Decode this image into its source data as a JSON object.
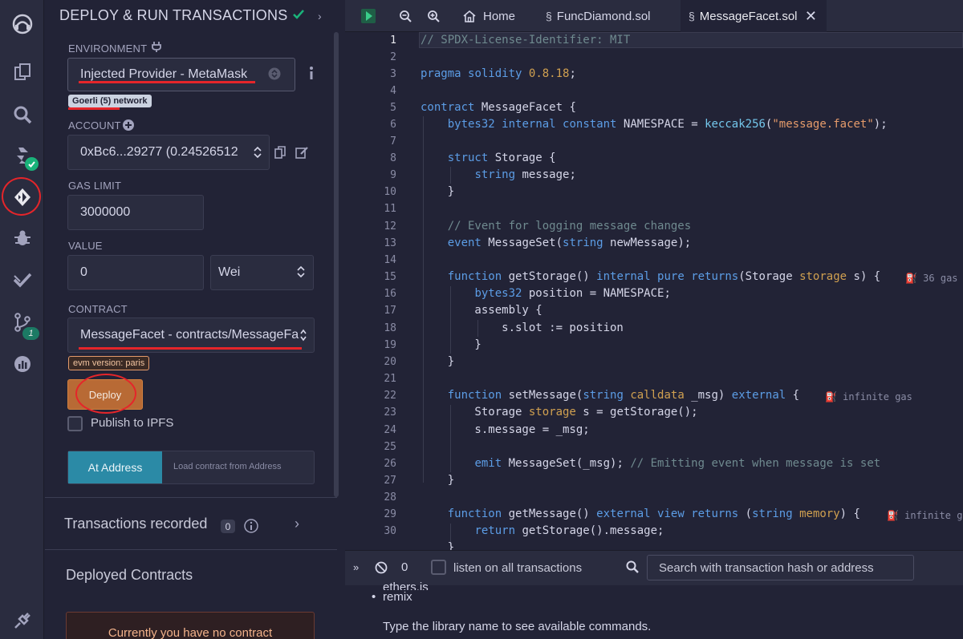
{
  "panel": {
    "title": "DEPLOY & RUN TRANSACTIONS",
    "environment_label": "ENVIRONMENT",
    "environment_value": "Injected Provider - MetaMask",
    "network_badge": "Goerli (5) network",
    "account_label": "ACCOUNT",
    "account_value": "0xBc6...29277 (0.24526512",
    "gas_limit_label": "GAS LIMIT",
    "gas_limit_value": "3000000",
    "value_label": "VALUE",
    "value_value": "0",
    "value_unit": "Wei",
    "contract_label": "CONTRACT",
    "contract_value": "MessageFacet - contracts/MessageFa",
    "evm_badge": "evm version: paris",
    "deploy_button": "Deploy",
    "publish_ipfs": "Publish to IPFS",
    "at_address_button": "At Address",
    "load_contract_placeholder": "Load contract from Address",
    "transactions_recorded": "Transactions recorded",
    "transactions_count": "0",
    "deployed_contracts": "Deployed Contracts",
    "no_contract_msg": "Currently you have no contract"
  },
  "tabs": [
    {
      "label": "Home"
    },
    {
      "label": "FuncDiamond.sol"
    },
    {
      "label": "MessageFacet.sol"
    }
  ],
  "editor": {
    "line_numbers": [
      "1",
      "2",
      "3",
      "4",
      "5",
      "6",
      "7",
      "8",
      "9",
      "10",
      "11",
      "12",
      "13",
      "14",
      "15",
      "16",
      "17",
      "18",
      "19",
      "20",
      "21",
      "22",
      "23",
      "24",
      "25",
      "26",
      "27",
      "28",
      "29",
      "30"
    ],
    "gas_hints": [
      "36 gas",
      "infinite gas",
      "infinite ga"
    ]
  },
  "terminal": {
    "count": "0",
    "listen_label": "listen on all transactions",
    "search_placeholder": "Search with transaction hash or address",
    "lines": [
      "ethers.js",
      "remix",
      "Type the library name to see available commands."
    ]
  }
}
